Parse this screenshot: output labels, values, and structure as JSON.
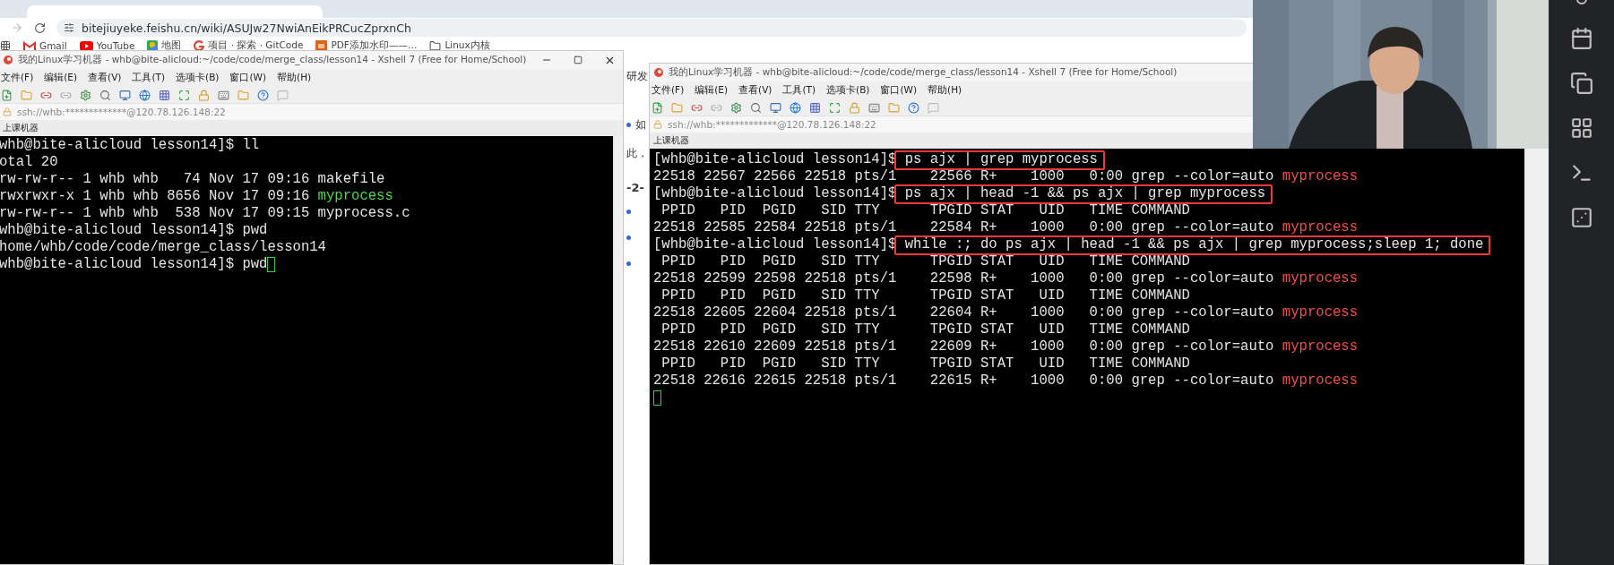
{
  "browser": {
    "url": "bitejiuyeke.feishu.cn/wiki/ASUJw27NwiAnEikPRCucZprxnCh",
    "bookmarks": [
      {
        "label": "Gmail",
        "kind": "gmail"
      },
      {
        "label": "YouTube",
        "kind": "youtube"
      },
      {
        "label": "地图",
        "kind": "maps"
      },
      {
        "label": "项目 · 探索 · GitCode",
        "kind": "gitcode"
      },
      {
        "label": "PDF添加水印——…",
        "kind": "pdf"
      },
      {
        "label": "Linux内核",
        "kind": "folder"
      }
    ]
  },
  "page_fragments": [
    {
      "kind": "text",
      "text": "研发"
    },
    {
      "kind": "bullet",
      "text": "如"
    },
    {
      "kind": "text",
      "text": "此，"
    },
    {
      "kind": "heading",
      "text": "-2-"
    },
    {
      "kind": "bullet"
    },
    {
      "kind": "bullet"
    },
    {
      "kind": "bullet"
    }
  ],
  "windows": [
    {
      "title": "我的Linux学习机器 - whb@bite-alicloud:~/code/code/merge_class/lesson14 - Xshell 7 (Free for Home/School)",
      "menu": [
        "文件(F)",
        "编辑(E)",
        "查看(V)",
        "工具(T)",
        "选项卡(B)",
        "窗口(W)",
        "帮助(H)"
      ],
      "address": "ssh://whb:*************@120.78.126.148:22",
      "tab": "上课机器",
      "terminal": {
        "lines": [
          {
            "kind": "prompt",
            "prompt": "whb@bite-alicloud lesson14]$",
            "command": "ll",
            "boxed": false,
            "cursor": false
          },
          {
            "kind": "output",
            "text": "otal 20"
          },
          {
            "kind": "output",
            "text": "rw-rw-r-- 1 whb whb   74 Nov 17 09:16 makefile"
          },
          {
            "kind": "output",
            "text": "rwxrwxr-x 1 whb whb 8656 Nov 17 09:16 ",
            "exec": "myprocess"
          },
          {
            "kind": "output",
            "text": "rw-rw-r-- 1 whb whb  538 Nov 17 09:15 myprocess.c"
          },
          {
            "kind": "prompt",
            "prompt": "whb@bite-alicloud lesson14]$",
            "command": "pwd",
            "boxed": false,
            "cursor": false
          },
          {
            "kind": "output",
            "text": "home/whb/code/code/merge_class/lesson14"
          },
          {
            "kind": "prompt",
            "prompt": "whb@bite-alicloud lesson14]$",
            "command": "pwd",
            "boxed": false,
            "cursor": true
          }
        ]
      }
    },
    {
      "title": "我的Linux学习机器 - whb@bite-alicloud:~/code/code/merge_class/lesson14 - Xshell 7 (Free for Home/School)",
      "menu": [
        "文件(F)",
        "编辑(E)",
        "查看(V)",
        "工具(T)",
        "选项卡(B)",
        "窗口(W)",
        "帮助(H)"
      ],
      "address": "ssh://whb:*************@120.78.126.148:22",
      "tab": "上课机器",
      "terminal": {
        "lines": [
          {
            "kind": "prompt",
            "prompt": "[whb@bite-alicloud lesson14]$",
            "command": "ps ajx | grep myprocess",
            "boxed": true,
            "cursor": false
          },
          {
            "kind": "output",
            "text": "22518 22567 22566 22518 pts/1    22566 R+    1000   0:00 grep --color=auto ",
            "match": "myprocess"
          },
          {
            "kind": "prompt",
            "prompt": "[whb@bite-alicloud lesson14]$",
            "command": "ps ajx | head -1 && ps ajx | grep myprocess",
            "boxed": true,
            "cursor": false
          },
          {
            "kind": "output",
            "text": " PPID   PID  PGID   SID TTY      TPGID STAT   UID   TIME COMMAND"
          },
          {
            "kind": "output",
            "text": "22518 22585 22584 22518 pts/1    22584 R+    1000   0:00 grep --color=auto ",
            "match": "myprocess"
          },
          {
            "kind": "prompt",
            "prompt": "[whb@bite-alicloud lesson14]$",
            "command": "while :; do ps ajx | head -1 && ps ajx | grep myprocess;sleep 1; done",
            "boxed": true,
            "cursor": false
          },
          {
            "kind": "output",
            "text": " PPID   PID  PGID   SID TTY      TPGID STAT   UID   TIME COMMAND"
          },
          {
            "kind": "output",
            "text": "22518 22599 22598 22518 pts/1    22598 R+    1000   0:00 grep --color=auto ",
            "match": "myprocess"
          },
          {
            "kind": "output",
            "text": " PPID   PID  PGID   SID TTY      TPGID STAT   UID   TIME COMMAND"
          },
          {
            "kind": "output",
            "text": "22518 22605 22604 22518 pts/1    22604 R+    1000   0:00 grep --color=auto ",
            "match": "myprocess"
          },
          {
            "kind": "output",
            "text": " PPID   PID  PGID   SID TTY      TPGID STAT   UID   TIME COMMAND"
          },
          {
            "kind": "output",
            "text": "22518 22610 22609 22518 pts/1    22609 R+    1000   0:00 grep --color=auto ",
            "match": "myprocess"
          },
          {
            "kind": "output",
            "text": " PPID   PID  PGID   SID TTY      TPGID STAT   UID   TIME COMMAND"
          },
          {
            "kind": "output",
            "text": "22518 22616 22615 22518 pts/1    22615 R+    1000   0:00 grep --color=auto ",
            "match": "myprocess"
          },
          {
            "kind": "blank",
            "cursor": true
          }
        ]
      }
    }
  ]
}
